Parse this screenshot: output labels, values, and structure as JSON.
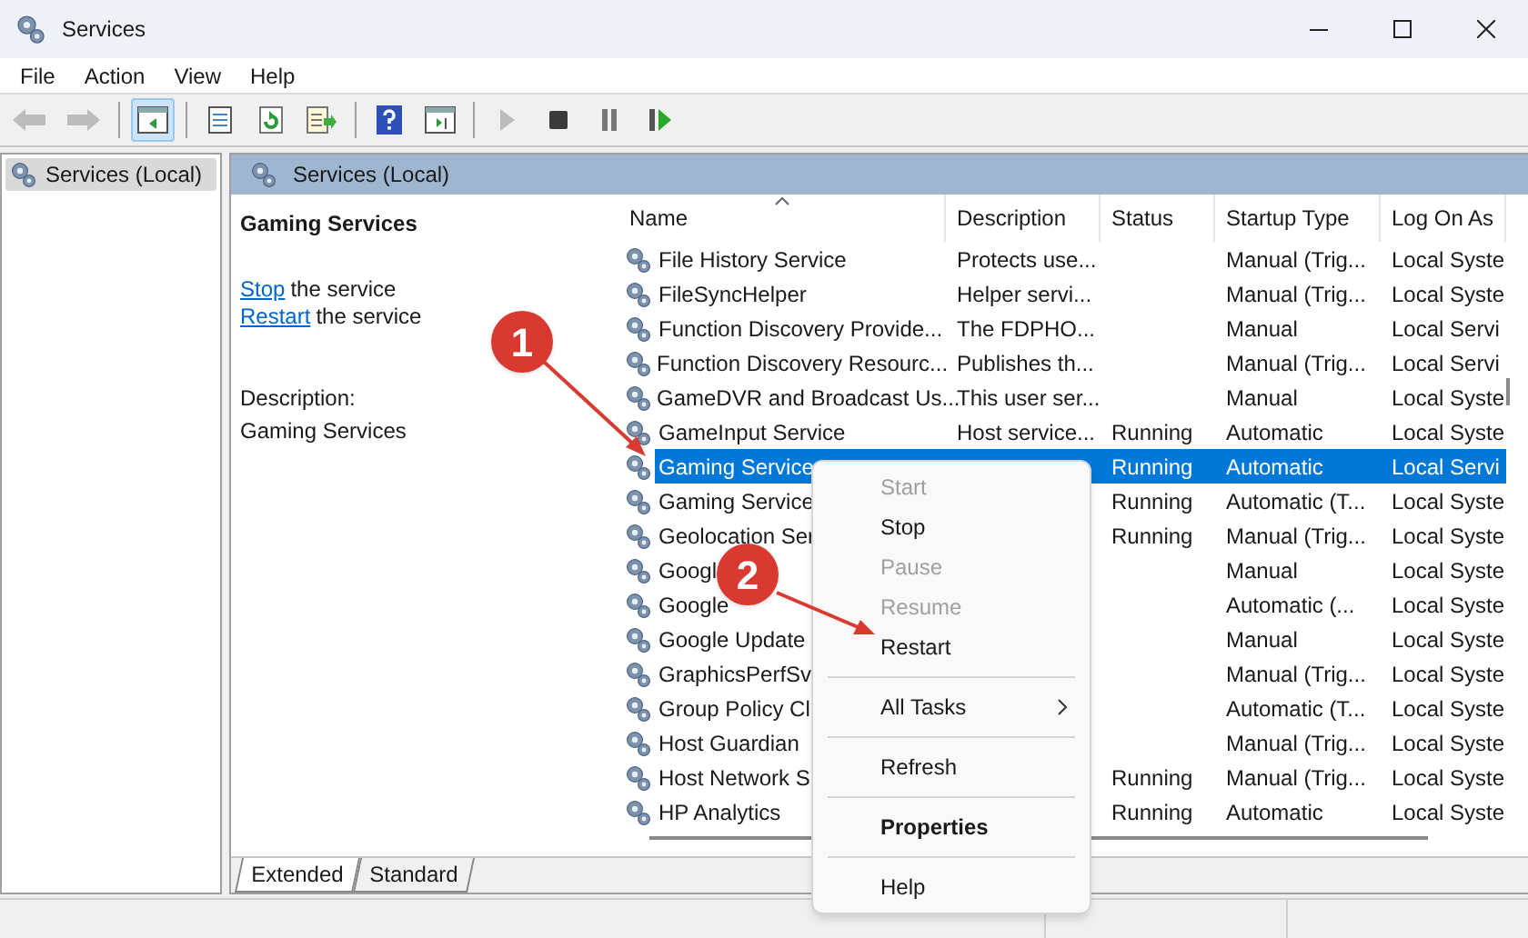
{
  "window": {
    "title": "Services"
  },
  "menu": [
    "File",
    "Action",
    "View",
    "Help"
  ],
  "toolbar": [
    {
      "kind": "back",
      "disabled": true,
      "pressed": false
    },
    {
      "kind": "forward",
      "disabled": true,
      "pressed": false
    },
    {
      "kind": "sep"
    },
    {
      "kind": "tree",
      "disabled": false,
      "pressed": true
    },
    {
      "kind": "sep"
    },
    {
      "kind": "list",
      "disabled": false,
      "pressed": false
    },
    {
      "kind": "refresh",
      "disabled": false,
      "pressed": false
    },
    {
      "kind": "export",
      "disabled": false,
      "pressed": false
    },
    {
      "kind": "sep"
    },
    {
      "kind": "help",
      "disabled": false,
      "pressed": false
    },
    {
      "kind": "props",
      "disabled": false,
      "pressed": false
    },
    {
      "kind": "sep"
    },
    {
      "kind": "start",
      "disabled": true,
      "pressed": false
    },
    {
      "kind": "stop",
      "disabled": false,
      "pressed": false
    },
    {
      "kind": "pause",
      "disabled": false,
      "pressed": false
    },
    {
      "kind": "restart",
      "disabled": false,
      "pressed": false
    }
  ],
  "tree": {
    "items": [
      {
        "label": "Services (Local)",
        "selected": true
      }
    ]
  },
  "panel_title": "Services (Local)",
  "details": {
    "title": "Gaming Services",
    "actions": [
      {
        "link": "Stop",
        "text": "the service"
      },
      {
        "link": "Restart",
        "text": "the service"
      }
    ],
    "description_label": "Description:",
    "description": "Gaming Services"
  },
  "table": {
    "columns": [
      "Name",
      "Description",
      "Status",
      "Startup Type",
      "Log On As"
    ],
    "rows": [
      {
        "name": "File History Service",
        "description": "Protects use...",
        "status": "",
        "startup": "Manual (Trig...",
        "logon": "Local Syste",
        "selected": false
      },
      {
        "name": "FileSyncHelper",
        "description": "Helper servi...",
        "status": "",
        "startup": "Manual (Trig...",
        "logon": "Local Syste",
        "selected": false
      },
      {
        "name": "Function Discovery Provide...",
        "description": "The FDPHO...",
        "status": "",
        "startup": "Manual",
        "logon": "Local Servi",
        "selected": false
      },
      {
        "name": "Function Discovery Resourc...",
        "description": "Publishes th...",
        "status": "",
        "startup": "Manual (Trig...",
        "logon": "Local Servi",
        "selected": false
      },
      {
        "name": "GameDVR and Broadcast Us...",
        "description": "This user ser...",
        "status": "",
        "startup": "Manual",
        "logon": "Local Syste",
        "selected": false
      },
      {
        "name": "GameInput Service",
        "description": "Host service...",
        "status": "Running",
        "startup": "Automatic",
        "logon": "Local Syste",
        "selected": false
      },
      {
        "name": "Gaming Service",
        "description": "",
        "status": "Running",
        "startup": "Automatic",
        "logon": "Local Servi",
        "selected": true
      },
      {
        "name": "Gaming Service",
        "description": "",
        "status": "Running",
        "startup": "Automatic (T...",
        "logon": "Local Syste",
        "selected": false
      },
      {
        "name": "Geolocation Ser",
        "description": "",
        "status": "Running",
        "startup": "Manual (Trig...",
        "logon": "Local Syste",
        "selected": false
      },
      {
        "name": "Googl",
        "description": "",
        "status": "",
        "startup": "Manual",
        "logon": "Local Syste",
        "selected": false
      },
      {
        "name": "Google",
        "description": "",
        "status": "",
        "startup": "Automatic (...",
        "logon": "Local Syste",
        "selected": false
      },
      {
        "name": "Google Update",
        "description": "",
        "status": "",
        "startup": "Manual",
        "logon": "Local Syste",
        "selected": false
      },
      {
        "name": "GraphicsPerfSv",
        "description": "",
        "status": "",
        "startup": "Manual (Trig...",
        "logon": "Local Syste",
        "selected": false
      },
      {
        "name": "Group Policy Cl",
        "description": "",
        "status": "",
        "startup": "Automatic (T...",
        "logon": "Local Syste",
        "selected": false
      },
      {
        "name": "Host Guardian",
        "description": "",
        "status": "",
        "startup": "Manual (Trig...",
        "logon": "Local Syste",
        "selected": false
      },
      {
        "name": "Host Network S",
        "description": "",
        "status": "Running",
        "startup": "Manual (Trig...",
        "logon": "Local Syste",
        "selected": false
      },
      {
        "name": "HP Analytics",
        "description": "",
        "status": "Running",
        "startup": "Automatic",
        "logon": "Local Syste",
        "selected": false
      }
    ]
  },
  "tabs": [
    {
      "label": "Extended",
      "selected": true
    },
    {
      "label": "Standard",
      "selected": false
    }
  ],
  "context_menu": [
    {
      "kind": "item",
      "label": "Start",
      "disabled": true,
      "default": false
    },
    {
      "kind": "item",
      "label": "Stop",
      "disabled": false,
      "default": false
    },
    {
      "kind": "item",
      "label": "Pause",
      "disabled": true,
      "default": false
    },
    {
      "kind": "item",
      "label": "Resume",
      "disabled": true,
      "default": false
    },
    {
      "kind": "item",
      "label": "Restart",
      "disabled": false,
      "default": false
    },
    {
      "kind": "separator"
    },
    {
      "kind": "submenu",
      "label": "All Tasks",
      "disabled": false,
      "default": false
    },
    {
      "kind": "separator"
    },
    {
      "kind": "item",
      "label": "Refresh",
      "disabled": false,
      "default": false
    },
    {
      "kind": "separator"
    },
    {
      "kind": "item",
      "label": "Properties",
      "disabled": false,
      "default": true
    },
    {
      "kind": "separator"
    },
    {
      "kind": "item",
      "label": "Help",
      "disabled": false,
      "default": false
    }
  ],
  "annotations": [
    {
      "label": "1"
    },
    {
      "label": "2"
    }
  ]
}
